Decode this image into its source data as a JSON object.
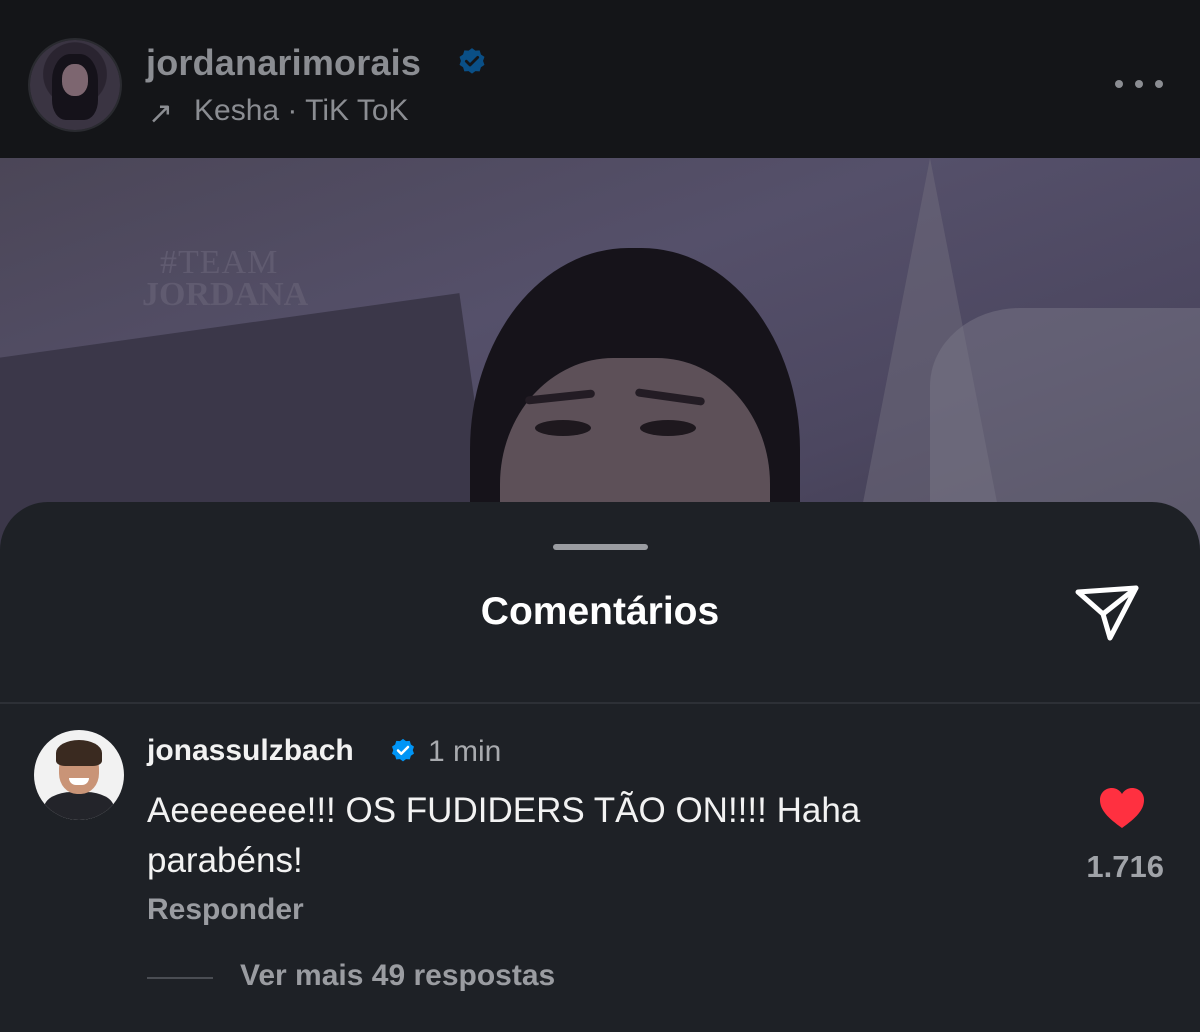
{
  "post": {
    "username": "jordanarimorais",
    "audio_artist": "Kesha",
    "audio_track": "TiK ToK",
    "subtitle": "Kesha · TiK ToK",
    "image_watermark_line1": "#TEAM",
    "image_watermark_line2": "JORDANA",
    "verified": true
  },
  "icons": {
    "verified": "verified-badge-icon",
    "music": "arrow-up-right-icon",
    "more": "more-horizontal-icon",
    "share": "paper-plane-icon",
    "like": "heart-filled-icon"
  },
  "sheet": {
    "title": "Comentários"
  },
  "comment": {
    "username": "jonassulzbach",
    "verified": true,
    "time": "1 min",
    "text": "Aeeeeeee!!! OS FUDIDERS TÃO ON!!!! Haha parabéns!",
    "reply_label": "Responder",
    "like_count": "1.716",
    "liked": true,
    "view_replies_label": "Ver mais 49 respostas"
  },
  "colors": {
    "sheet_bg": "#1e2126",
    "verified_blue": "#0095f6",
    "heart_red": "#ff3040",
    "muted_text": "#9a9ca1"
  }
}
